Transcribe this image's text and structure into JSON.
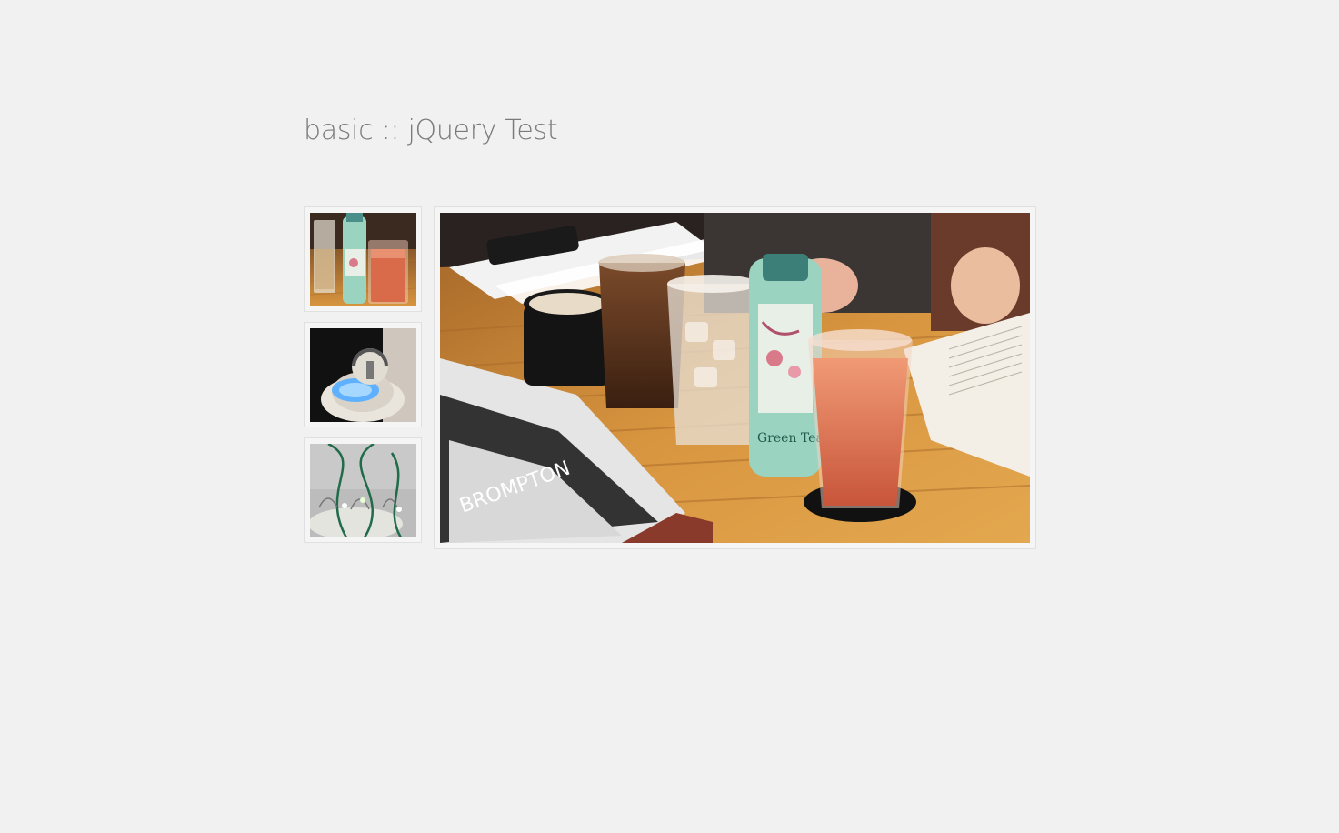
{
  "page": {
    "title": "basic :: jQuery Test"
  },
  "gallery": {
    "thumbnails": [
      {
        "subject": "iced drinks and green tea bottle on wooden table"
      },
      {
        "subject": "white robot with glowing blue face"
      },
      {
        "subject": "LED lights with green wires"
      }
    ],
    "main_image": {
      "subject": "iced drinks, coffee cup and green tea bottle on wooden table with magazines",
      "bottle_label": "Green Tea",
      "magazine_label": "BROMPTON"
    }
  },
  "colors": {
    "background": "#f1f1f1",
    "frame_border": "#e0e0e0",
    "title_text": "#7a7a7a",
    "wood": "#c98a3c",
    "drink_red": "#d96b4a",
    "tea_bottle": "#9ad3c0"
  }
}
